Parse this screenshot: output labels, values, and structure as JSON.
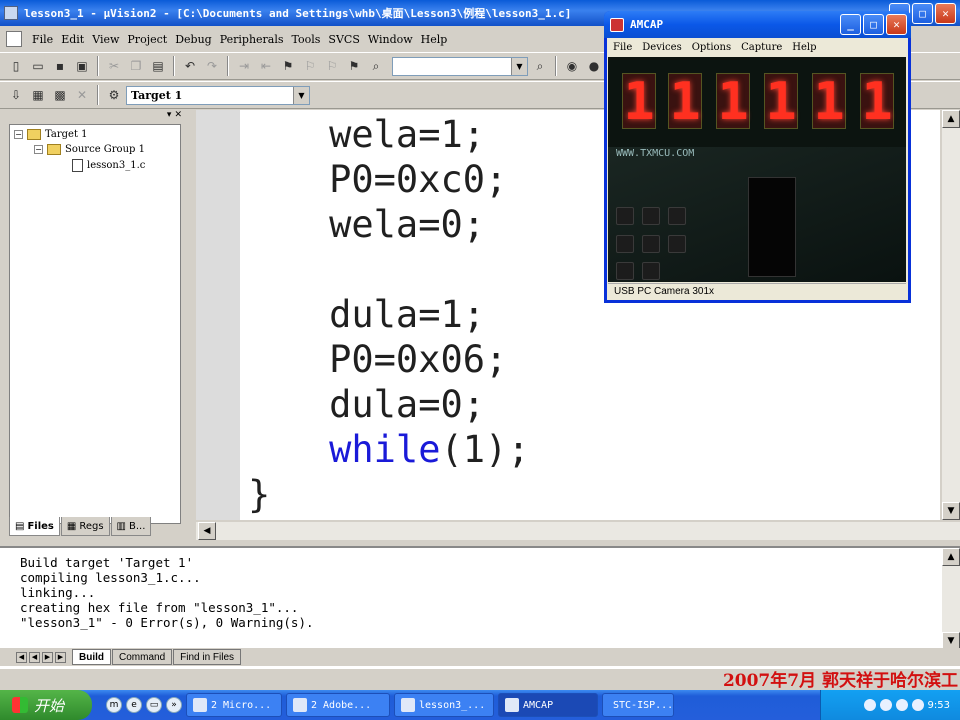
{
  "window": {
    "title": "lesson3_1  - μVision2 - [C:\\Documents and Settings\\whb\\桌面\\Lesson3\\例程\\lesson3_1.c]"
  },
  "menu": [
    "File",
    "Edit",
    "View",
    "Project",
    "Debug",
    "Peripherals",
    "Tools",
    "SVCS",
    "Window",
    "Help"
  ],
  "toolbar2": {
    "target": "Target 1"
  },
  "project": {
    "target": "Target 1",
    "group": "Source Group 1",
    "file": "lesson3_1.c",
    "tabs": [
      "Files",
      "Regs",
      "B..."
    ]
  },
  "code": {
    "l1": "    wela=1;",
    "l2": "    P0=0xc0;",
    "l3": "    wela=0;",
    "l4": "",
    "l5": "    dula=1;",
    "l6": "    P0=0x06;",
    "l7": "    dula=0;",
    "l8_kw": "while",
    "l8_rest": "(1);",
    "l9": "}"
  },
  "output": {
    "lines": [
      "Build target 'Target 1'",
      "compiling lesson3_1.c...",
      "linking...",
      "creating hex file from \"lesson3_1\"...",
      "\"lesson3_1\" - 0 Error(s), 0 Warning(s)."
    ],
    "tabs": [
      "Build",
      "Command",
      "Find in Files"
    ]
  },
  "watermark": "2007年7月  郭天祥于哈尔滨工",
  "amcap": {
    "title": "AMCAP",
    "menu": [
      "File",
      "Devices",
      "Options",
      "Capture",
      "Help"
    ],
    "status": "USB PC Camera 301x",
    "silkscreen": "WWW.TXMCU.COM",
    "digits": [
      "1",
      "1",
      "1",
      "1",
      "1",
      "1"
    ]
  },
  "taskbar": {
    "start": "开始",
    "tasks": [
      "2 Micro...",
      "2 Adobe...",
      "lesson3_...",
      "AMCAP",
      "STC-ISP..."
    ],
    "clock": "9:53"
  }
}
